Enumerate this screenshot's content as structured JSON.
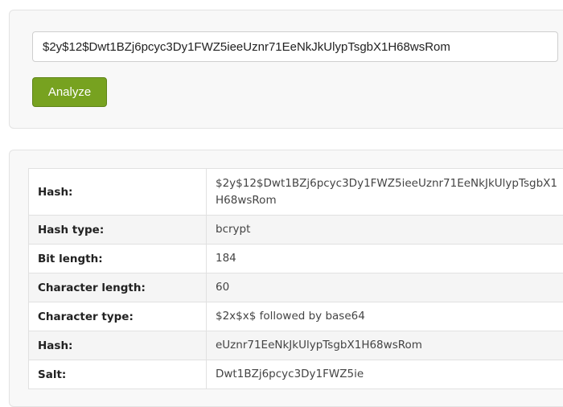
{
  "input": {
    "value": "$2y$12$Dwt1BZj6pcyc3Dy1FWZ5ieeUznr71EeNkJkUlypTsgbX1H68wsRom"
  },
  "analyze_button": {
    "label": "Analyze"
  },
  "results": {
    "rows": [
      {
        "label": "Hash:",
        "value": "$2y$12$Dwt1BZj6pcyc3Dy1FWZ5ieeUznr71EeNkJkUlypTsgbX1H68wsRom"
      },
      {
        "label": "Hash type:",
        "value": "bcrypt"
      },
      {
        "label": "Bit length:",
        "value": "184"
      },
      {
        "label": "Character length:",
        "value": "60"
      },
      {
        "label": "Character type:",
        "value": "$2x$x$ followed by base64"
      },
      {
        "label": "Hash:",
        "value": "eUznr71EeNkJkUlypTsgbX1H68wsRom"
      },
      {
        "label": "Salt:",
        "value": "Dwt1BZj6pcyc3Dy1FWZ5ie"
      }
    ]
  }
}
